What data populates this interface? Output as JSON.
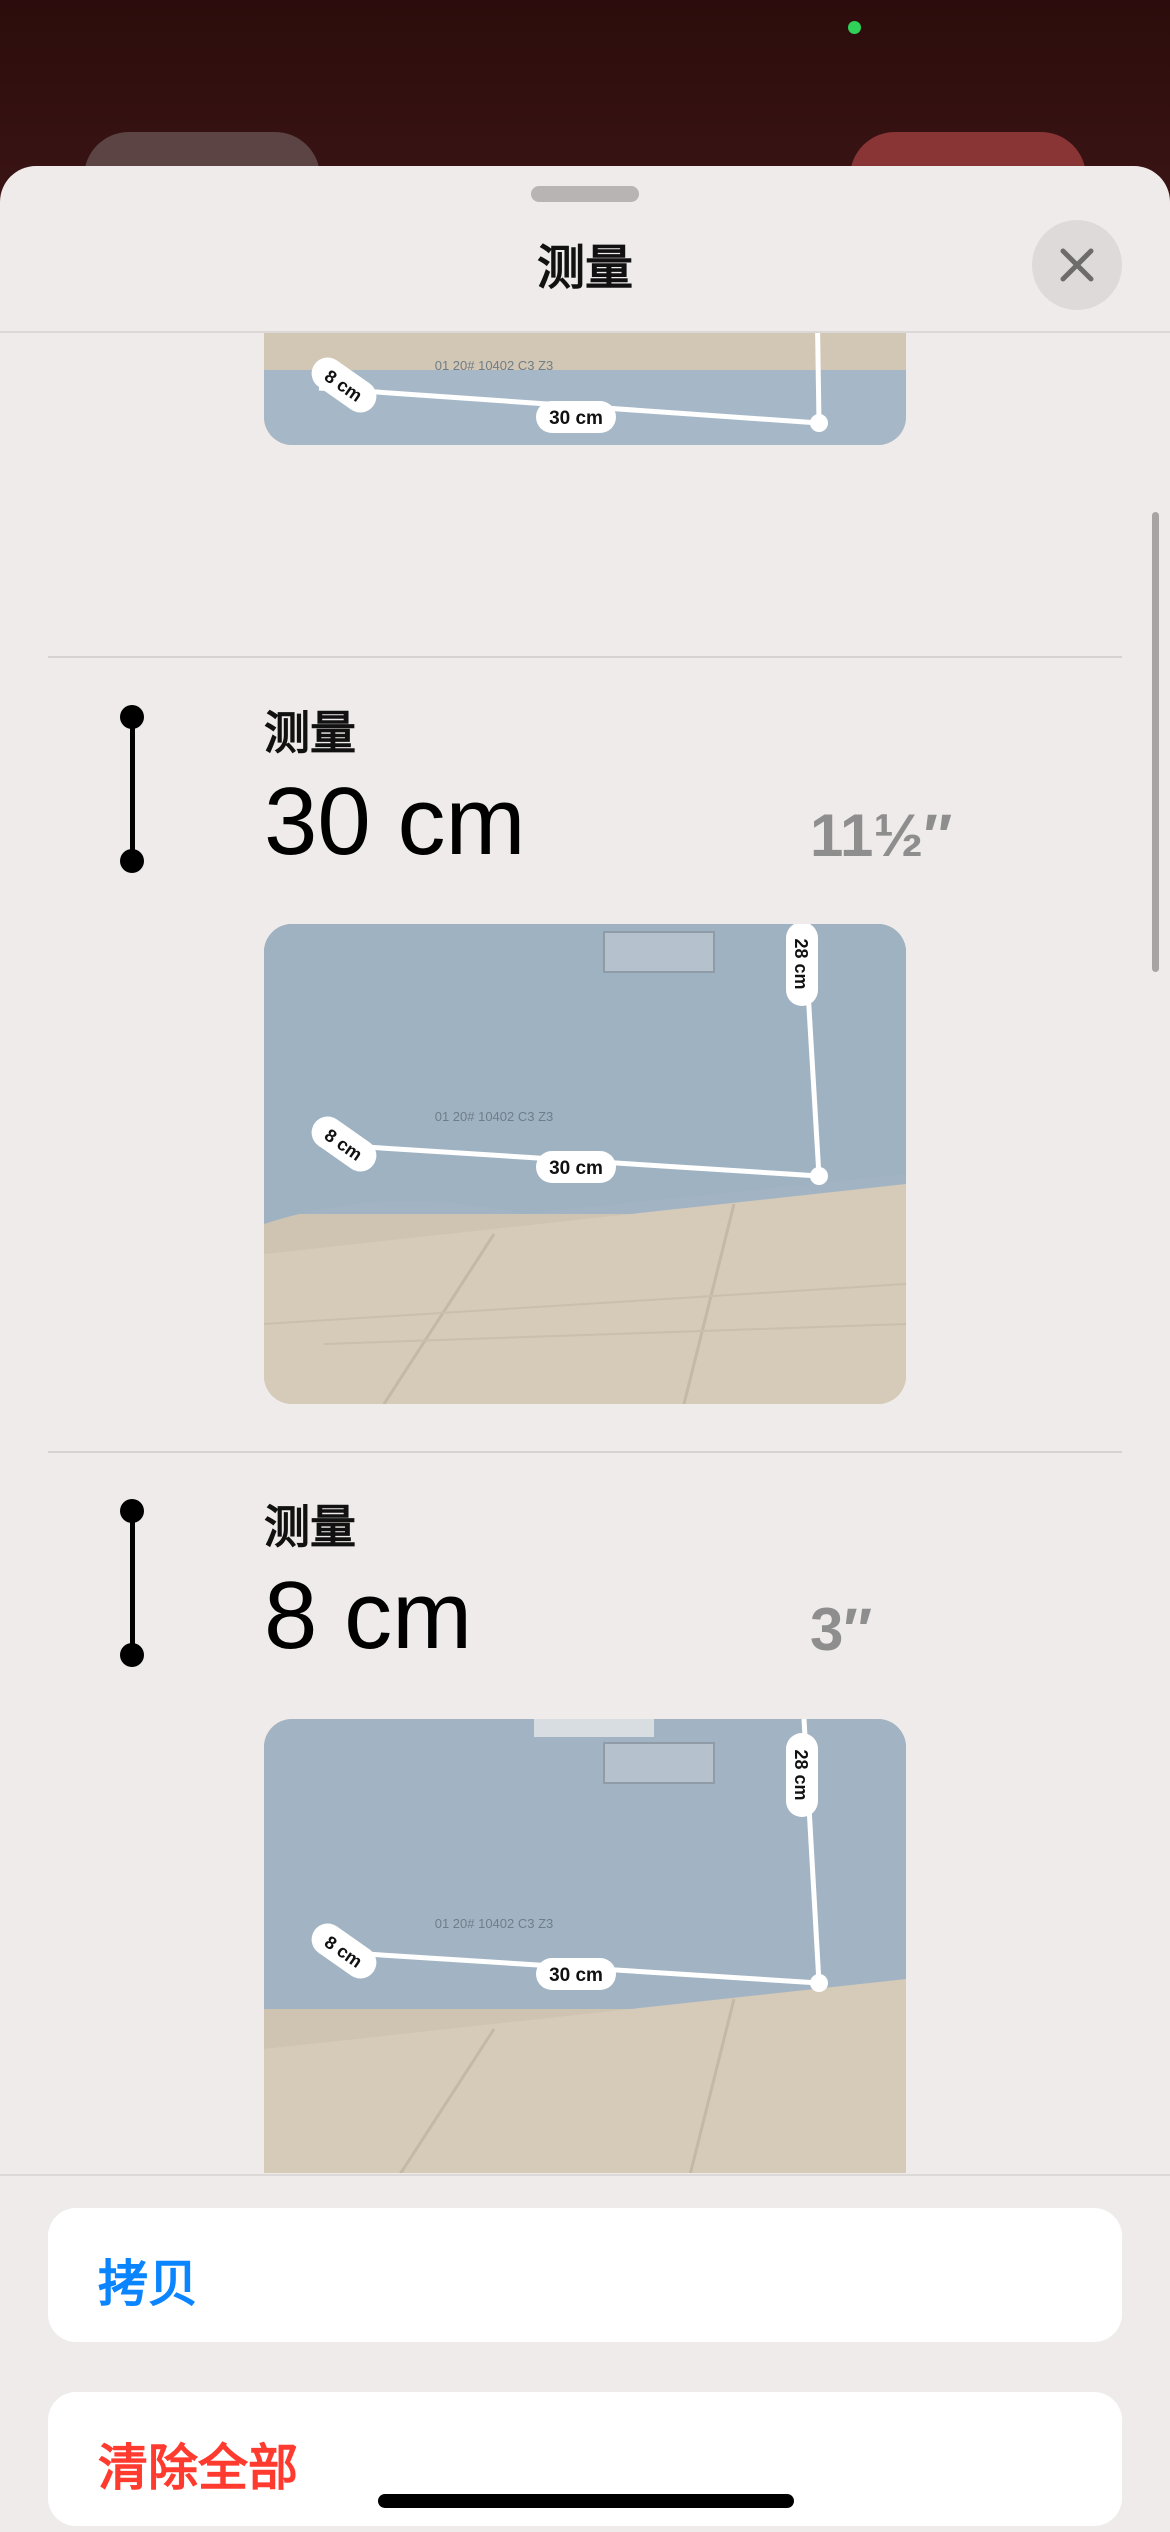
{
  "sheet": {
    "title": "测量",
    "close_icon": "close-icon"
  },
  "measurements": [
    {
      "label": "测量",
      "value": "30 cm",
      "imperial": "11½″"
    },
    {
      "label": "测量",
      "value": "8 cm",
      "imperial": "3″"
    }
  ],
  "photo_labels": {
    "length": "30 cm",
    "depth": "8 cm",
    "height": "28 cm",
    "package_print": "01 20# 10402 C3 Z3"
  },
  "actions": {
    "copy_label": "拷贝",
    "clear_label": "清除全部"
  },
  "colors": {
    "accent_blue": "#0a84ff",
    "destructive_red": "#ff3b30",
    "sheet_bg": "#efebea"
  }
}
